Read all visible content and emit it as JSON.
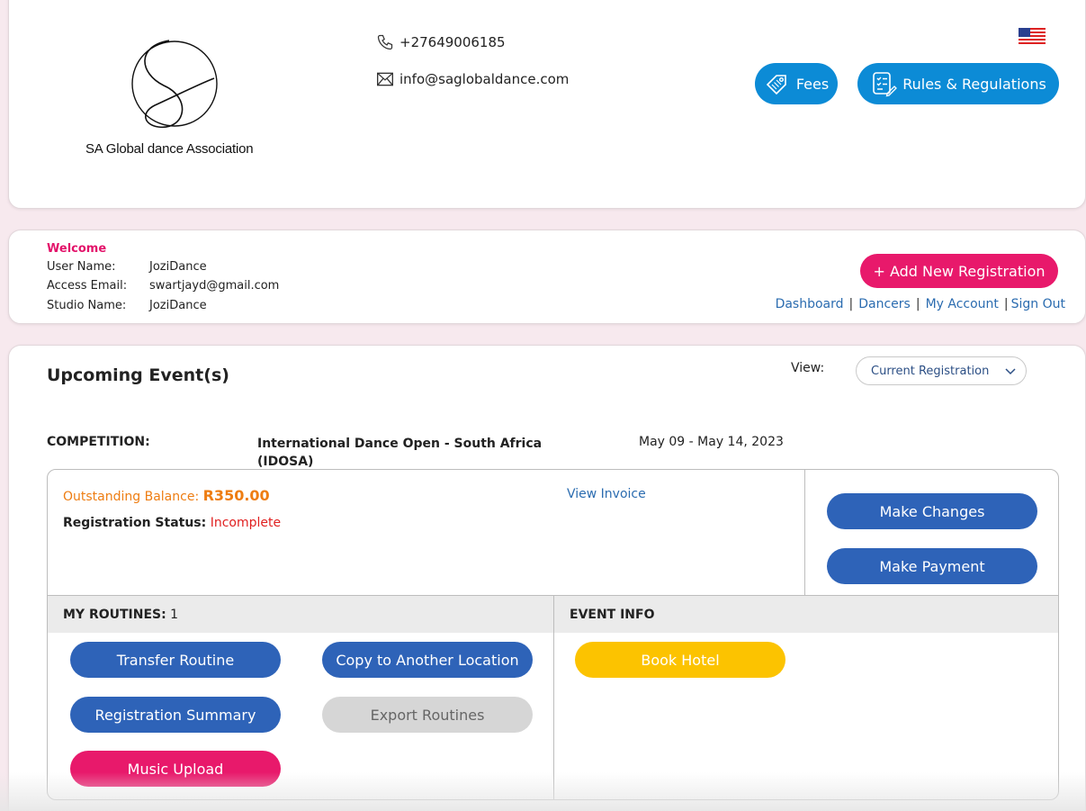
{
  "header": {
    "logo_text": "SA Global dance Association",
    "phone": "+27649006185",
    "email": "info@saglobaldance.com",
    "fees_label": "Fees",
    "rules_label": "Rules & Regulations",
    "colors": {
      "pill_blue": "#0c8bd6"
    }
  },
  "user": {
    "welcome": "Welcome",
    "rows": [
      {
        "label": "User Name:",
        "value": "JoziDance"
      },
      {
        "label": "Access Email:",
        "value": "swartjayd@gmail.com"
      },
      {
        "label": "Studio Name:",
        "value": "JoziDance"
      }
    ],
    "add_button": "+ Add New Registration",
    "nav": [
      "Dashboard",
      "Dancers",
      "My Account",
      "Sign Out"
    ]
  },
  "events": {
    "title": "Upcoming Event(s)",
    "view_label": "View:",
    "view_selected": "Current Registration",
    "competition_label": "COMPETITION:",
    "competition_name": "International Dance Open - South Africa (IDOSA)",
    "competition_dates": "May 09 - May 14, 2023",
    "balance_label": "Outstanding Balance:",
    "balance_value": "R350.00",
    "status_label": "Registration Status:",
    "status_value": "Incomplete",
    "view_invoice": "View Invoice",
    "make_changes": "Make Changes",
    "make_payment": "Make Payment",
    "routines_label": "MY ROUTINES:",
    "routines_count": "1",
    "event_info_label": "EVENT INFO",
    "buttons": {
      "transfer": "Transfer Routine",
      "copy": "Copy to Another Location",
      "summary": "Registration Summary",
      "export": "Export Routines",
      "music": "Music Upload",
      "hotel": "Book Hotel"
    },
    "colors": {
      "dark_blue": "#2e63b8",
      "pink": "#e8196b",
      "yellow": "#fcc300",
      "disabled": "#d6d6d6",
      "orange": "#ee7d12",
      "red": "#e02020"
    }
  }
}
